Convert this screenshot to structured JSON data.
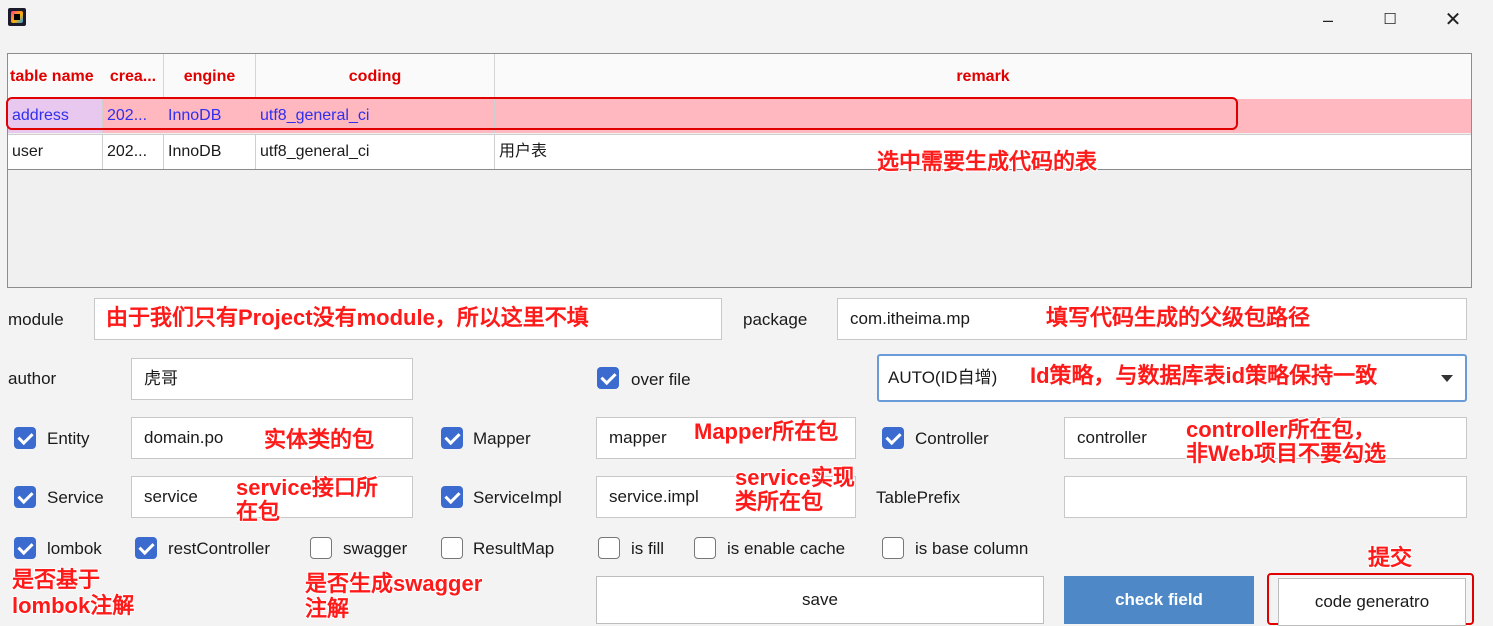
{
  "window": {
    "minimize": "–",
    "maximize": "☐",
    "close": "✕"
  },
  "table": {
    "headers": [
      "table name",
      "crea...",
      "engine",
      "coding",
      "remark"
    ],
    "rows": [
      [
        "address",
        "202...",
        "InnoDB",
        "utf8_general_ci",
        ""
      ],
      [
        "user",
        "202...",
        "InnoDB",
        "utf8_general_ci",
        "用户表"
      ]
    ],
    "selected_row": 0,
    "highlight_color": "#ffb7c0"
  },
  "annotations": {
    "select_table": "选中需要生成代码的表",
    "module": "由于我们只有Project没有module，所以这里不填",
    "package": "填写代码生成的父级包路径",
    "id_strategy": "Id策略，与数据库表id策略保持一致",
    "entity": "实体类的包",
    "mapper": "Mapper所在包",
    "controller_1": "controller所在包，",
    "controller_2": "非Web项目不要勾选",
    "service_1": "service接口所",
    "service_2": "在包",
    "serviceimpl_1": "service实现",
    "serviceimpl_2": "类所在包",
    "lombok_1": "是否基于",
    "lombok_2": "lombok注解",
    "swagger_1": "是否生成swagger",
    "swagger_2": "注解",
    "submit": "提交"
  },
  "form": {
    "module_label": "module",
    "module_value": "",
    "package_label": "package",
    "package_value": "com.itheima.mp",
    "author_label": "author",
    "author_value": "虎哥",
    "over_file_label": "over file",
    "over_file_checked": true,
    "id_type_value": "AUTO(ID自增)",
    "entity_label": "Entity",
    "entity_checked": true,
    "entity_value": "domain.po",
    "mapper_label": "Mapper",
    "mapper_checked": true,
    "mapper_value": "mapper",
    "controller_label": "Controller",
    "controller_checked": true,
    "controller_value": "controller",
    "service_label": "Service",
    "service_checked": true,
    "service_value": "service",
    "serviceimpl_label": "ServiceImpl",
    "serviceimpl_checked": true,
    "serviceimpl_value": "service.impl",
    "tableprefix_label": "TablePrefix",
    "tableprefix_value": "",
    "options": [
      {
        "label": "lombok",
        "checked": true
      },
      {
        "label": "restController",
        "checked": true
      },
      {
        "label": "swagger",
        "checked": false
      },
      {
        "label": "ResultMap",
        "checked": false
      },
      {
        "label": "is fill",
        "checked": false
      },
      {
        "label": "is enable cache",
        "checked": false
      },
      {
        "label": "is base column",
        "checked": false
      }
    ]
  },
  "buttons": {
    "save": "save",
    "check_field": "check field",
    "code_generatro": "code generatro"
  },
  "colors": {
    "accent": "#4f88c6",
    "checkbox": "#3c6bcf",
    "annotation": "#ff1a1a",
    "header_text": "#e00000"
  }
}
